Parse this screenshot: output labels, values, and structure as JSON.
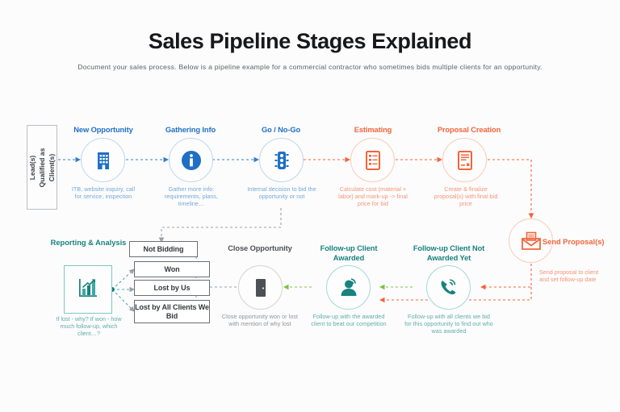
{
  "page": {
    "title": "Sales Pipeline Stages Explained",
    "subtitle": "Document your sales process. Below is a pipeline example for a commercial contractor who sometimes bids multiple clients for an opportunity."
  },
  "colors": {
    "blue": "#1f6fc4",
    "orange": "#f4643a",
    "teal": "#17827e",
    "gray": "#4d5156",
    "green_connector": "#7ac143",
    "background": "#fcfcfc"
  },
  "entry": {
    "label": "Lead(s)\nQualified as\nClient(s)",
    "line1": "Lead(s)",
    "line2": "Qualified as",
    "line3": "Client(s)"
  },
  "stages": [
    {
      "id": "new-opportunity",
      "title": "New Opportunity",
      "caption": "ITB, website inquiry, call for service, inspection",
      "icon": "building-icon",
      "color": "blue"
    },
    {
      "id": "gathering-info",
      "title": "Gathering Info",
      "caption": "Gather more info: requirements, plans, timeline…",
      "icon": "info-icon",
      "color": "blue"
    },
    {
      "id": "go-no-go",
      "title": "Go / No-Go",
      "caption": "Internal decision to bid the opportunity or not",
      "icon": "traffic-light-icon",
      "color": "blue"
    },
    {
      "id": "estimating",
      "title": "Estimating",
      "caption": "Calculate cost (material + labor) and mark-up -> final price for bid",
      "icon": "checklist-icon",
      "color": "orange"
    },
    {
      "id": "proposal-creation",
      "title": "Proposal Creation",
      "caption": "Create & finalize proposal(s) with final bid price",
      "icon": "document-icon",
      "color": "orange"
    },
    {
      "id": "send-proposals",
      "title": "Send Proposal(s)",
      "caption": "Send proposal to client and set follow-up date",
      "icon": "envelope-icon",
      "color": "orange"
    },
    {
      "id": "follow-up-not-awarded",
      "title": "Follow-up Client Not Awarded Yet",
      "caption": "Follow-up with all clients we bid for this opportunity to find out who was awarded",
      "icon": "ringing-phone-icon",
      "color": "teal"
    },
    {
      "id": "follow-up-awarded",
      "title": "Follow-up Client Awarded",
      "caption": "Follow-up with the awarded client to beat our competition",
      "icon": "support-agent-icon",
      "color": "teal"
    },
    {
      "id": "close-opportunity",
      "title": "Close Opportunity",
      "caption": "Close opportunity won or lost with mention of why lost",
      "icon": "door-icon",
      "color": "gray"
    },
    {
      "id": "reporting-analysis",
      "title": "Reporting & Analysis",
      "caption": "If lost - why? If won - how much follow-up, which client…?",
      "icon": "bar-chart-trend-icon",
      "color": "teal"
    }
  ],
  "outcomes": [
    {
      "id": "not-bidding",
      "label": "Not Bidding"
    },
    {
      "id": "won",
      "label": "Won"
    },
    {
      "id": "lost-by-us",
      "label": "Lost by Us"
    },
    {
      "id": "lost-by-all-clients",
      "label": "Lost by All Clients We Bid"
    }
  ]
}
